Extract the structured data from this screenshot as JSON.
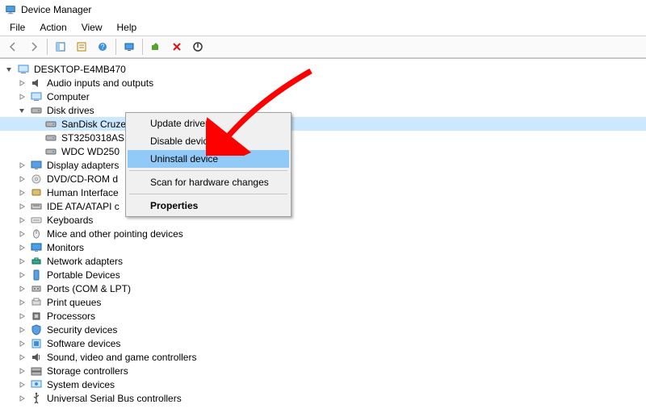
{
  "window": {
    "title": "Device Manager"
  },
  "menubar": [
    "File",
    "Action",
    "View",
    "Help"
  ],
  "root": {
    "name": "DESKTOP-E4MB470"
  },
  "categories": [
    {
      "id": "audio",
      "label": "Audio inputs and outputs",
      "expanded": false
    },
    {
      "id": "computer",
      "label": "Computer",
      "expanded": false
    },
    {
      "id": "disk",
      "label": "Disk drives",
      "expanded": true,
      "children": [
        {
          "id": "sandisk",
          "label": "SanDisk Cruzer Force USB Device",
          "selected": true
        },
        {
          "id": "st3250",
          "label": "ST3250318AS"
        },
        {
          "id": "wdc",
          "label": "WDC WD250"
        }
      ]
    },
    {
      "id": "display",
      "label": "Display adapters",
      "expanded": false
    },
    {
      "id": "dvd",
      "label": "DVD/CD-ROM d",
      "expanded": false
    },
    {
      "id": "hid",
      "label": "Human Interface",
      "expanded": false
    },
    {
      "id": "ide",
      "label": "IDE ATA/ATAPI c",
      "expanded": false
    },
    {
      "id": "keyboards",
      "label": "Keyboards",
      "expanded": false
    },
    {
      "id": "mice",
      "label": "Mice and other pointing devices",
      "expanded": false
    },
    {
      "id": "monitors",
      "label": "Monitors",
      "expanded": false
    },
    {
      "id": "network",
      "label": "Network adapters",
      "expanded": false
    },
    {
      "id": "portable",
      "label": "Portable Devices",
      "expanded": false
    },
    {
      "id": "ports",
      "label": "Ports (COM & LPT)",
      "expanded": false
    },
    {
      "id": "print",
      "label": "Print queues",
      "expanded": false
    },
    {
      "id": "processors",
      "label": "Processors",
      "expanded": false
    },
    {
      "id": "security",
      "label": "Security devices",
      "expanded": false
    },
    {
      "id": "software",
      "label": "Software devices",
      "expanded": false
    },
    {
      "id": "sound",
      "label": "Sound, video and game controllers",
      "expanded": false
    },
    {
      "id": "storage",
      "label": "Storage controllers",
      "expanded": false
    },
    {
      "id": "system",
      "label": "System devices",
      "expanded": false
    },
    {
      "id": "usb",
      "label": "Universal Serial Bus controllers",
      "expanded": false
    }
  ],
  "context_menu": {
    "items": [
      {
        "id": "update",
        "label": "Update driver"
      },
      {
        "id": "disable",
        "label": "Disable device"
      },
      {
        "id": "uninstall",
        "label": "Uninstall device",
        "highlighted": true
      },
      {
        "sep": true
      },
      {
        "id": "scan",
        "label": "Scan for hardware changes"
      },
      {
        "sep": true
      },
      {
        "id": "props",
        "label": "Properties",
        "bold": true
      }
    ]
  },
  "colors": {
    "highlight": "#cce8ff",
    "arrow": "#ff0000"
  }
}
